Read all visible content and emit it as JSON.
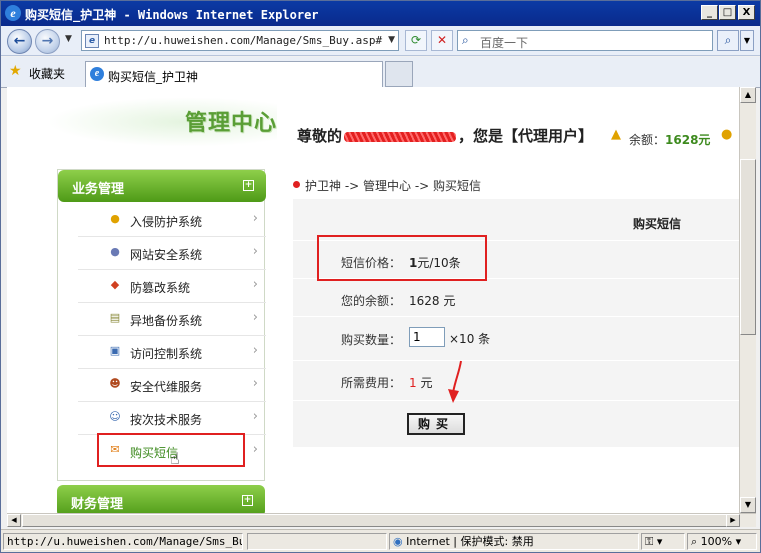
{
  "window": {
    "title": "购买短信_护卫神 - Windows Internet Explorer",
    "min": "_",
    "max": "□",
    "close": "X"
  },
  "address_bar": {
    "url": "http://u.huweishen.com/Manage/Sms_Buy.asp#",
    "search_placeholder": "百度一下"
  },
  "favorites": {
    "label": "收藏夹",
    "tab_title": "购买短信_护卫神"
  },
  "header": {
    "logo": "管理中心",
    "greeting_prefix": "尊敬的",
    "greeting_suffix": "，您是【代理用户】",
    "balance_label": "余额：",
    "balance_value": "1628元"
  },
  "sidebar": {
    "section1": "业务管理",
    "items": [
      {
        "label": "入侵防护系统",
        "icon": "lightbulb-icon"
      },
      {
        "label": "网站安全系统",
        "icon": "lightbulb-icon"
      },
      {
        "label": "防篡改系统",
        "icon": "shield-icon"
      },
      {
        "label": "异地备份系统",
        "icon": "database-icon"
      },
      {
        "label": "访问控制系统",
        "icon": "phone-icon"
      },
      {
        "label": "安全代维服务",
        "icon": "users-icon"
      },
      {
        "label": "按次技术服务",
        "icon": "user-icon"
      },
      {
        "label": "购买短信",
        "icon": "mail-icon"
      }
    ],
    "section2": "财务管理"
  },
  "breadcrumb": "护卫神 -> 管理中心 -> 购买短信",
  "form": {
    "title": "购买短信",
    "price_label": "短信价格：",
    "price_value_bold": "1",
    "price_value_rest": "元/10条",
    "balance_label": "您的余额：",
    "balance_value": "1628 元",
    "qty_label": "购买数量：",
    "qty_value": "1",
    "qty_unit": "×10 条",
    "cost_label": "所需费用：",
    "cost_value": "1",
    "cost_unit": "元",
    "buy_button": "购买"
  },
  "statusbar": {
    "url": "http://u.huweishen.com/Manage/Sms_Buy.asp",
    "zone": "Internet | 保护模式: 禁用",
    "zoom": "100%"
  },
  "colors": {
    "accent_green": "#4e9a17",
    "highlight_red": "#e02020"
  }
}
